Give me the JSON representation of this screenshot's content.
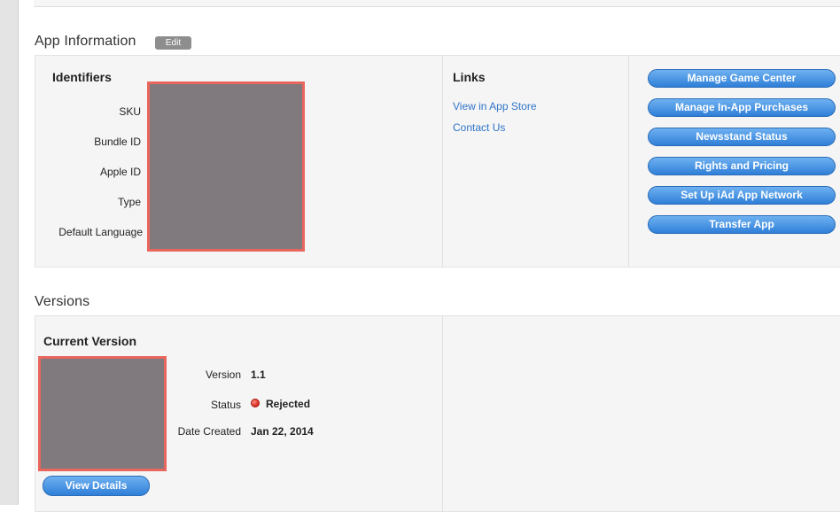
{
  "app_information": {
    "title": "App Information",
    "edit_label": "Edit",
    "identifiers": {
      "heading": "Identifiers",
      "labels": [
        "SKU",
        "Bundle ID",
        "Apple ID",
        "Type",
        "Default Language"
      ]
    },
    "links": {
      "heading": "Links",
      "items": [
        "View in App Store",
        "Contact Us"
      ]
    },
    "actions": [
      "Manage Game Center",
      "Manage In-App Purchases",
      "Newsstand Status",
      "Rights and Pricing",
      "Set Up iAd App Network",
      "Transfer App"
    ]
  },
  "versions": {
    "title": "Versions",
    "current": {
      "heading": "Current Version",
      "version_label": "Version",
      "version_value": "1.1",
      "status_label": "Status",
      "status_value": "Rejected",
      "status_color": "#d3261a",
      "date_label": "Date Created",
      "date_value": "Jan 22, 2014",
      "view_details_label": "View Details"
    }
  },
  "colors": {
    "accent_blue": "#2f7fd8",
    "link_blue": "#2f74c9",
    "redaction_fill": "#807a7f",
    "redaction_border": "#e9665d"
  }
}
